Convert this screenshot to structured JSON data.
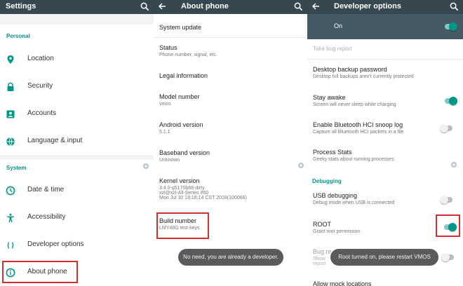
{
  "settings": {
    "title": "Settings",
    "section_personal": "Personal",
    "personal_items": [
      {
        "label": "Location",
        "icon": "location-pin-icon"
      },
      {
        "label": "Security",
        "icon": "lock-icon"
      },
      {
        "label": "Accounts",
        "icon": "account-card-icon"
      },
      {
        "label": "Language & input",
        "icon": "globe-icon"
      }
    ],
    "section_system": "System",
    "system_items": [
      {
        "label": "Date & time",
        "icon": "clock-icon"
      },
      {
        "label": "Accessibility",
        "icon": "accessibility-icon"
      },
      {
        "label": "Developer options",
        "icon": "code-braces-icon"
      },
      {
        "label": "About phone",
        "icon": "info-icon"
      }
    ]
  },
  "about": {
    "title": "About phone",
    "system_update": "System update",
    "status_title": "Status",
    "status_summary": "Phone number, signal, etc.",
    "legal": "Legal information",
    "model_title": "Model number",
    "model_value": "vmos",
    "android_title": "Android version",
    "android_value": "5.1.1",
    "baseband_title": "Baseband version",
    "baseband_value": "Unknown",
    "kernel_title": "Kernel version",
    "kernel_line1": "3.4.0-g5170b88-dirty",
    "kernel_line2": "xzl@xzl-All-Series #60",
    "kernel_line3": "Mon Jul 30 18:18:14 CST 2018(100066)",
    "build_title": "Build number",
    "build_value": "LMY48G test-keys",
    "toast": "No need, you are already a developer."
  },
  "developer": {
    "title": "Developer options",
    "master_label": "On",
    "master_on": true,
    "take_bug_report": "Take bug report",
    "backup_title": "Desktop backup password",
    "backup_summary": "Desktop full backups aren't currently protected",
    "stay_awake_title": "Stay awake",
    "stay_awake_summary": "Screen will never sleep while charging",
    "stay_awake_on": true,
    "hci_title": "Enable Bluetooth HCI snoop log",
    "hci_summary": "Capture all Bluetooth HCI packets in a file",
    "hci_on": false,
    "process_title": "Process Stats",
    "process_summary": "Geeky stats about running processes",
    "section_debugging": "Debugging",
    "usb_title": "USB debugging",
    "usb_summary": "Debug mode when USB is connected",
    "usb_on": false,
    "root_title": "ROOT",
    "root_summary": "Grant root permission",
    "root_on": true,
    "bug_partial_title": "Bug re",
    "bug_partial_summary1": "Show",
    "bug_partial_summary2": "report",
    "bug_partial_on": false,
    "allow_mock_partial": "Allow mock locations",
    "toast": "Root turned on, please restart VMOS"
  },
  "colors": {
    "toolbar": "#37474f",
    "accent": "#009688",
    "highlight_box": "#d32f2f",
    "toast_bg": "#5a5a5a"
  }
}
